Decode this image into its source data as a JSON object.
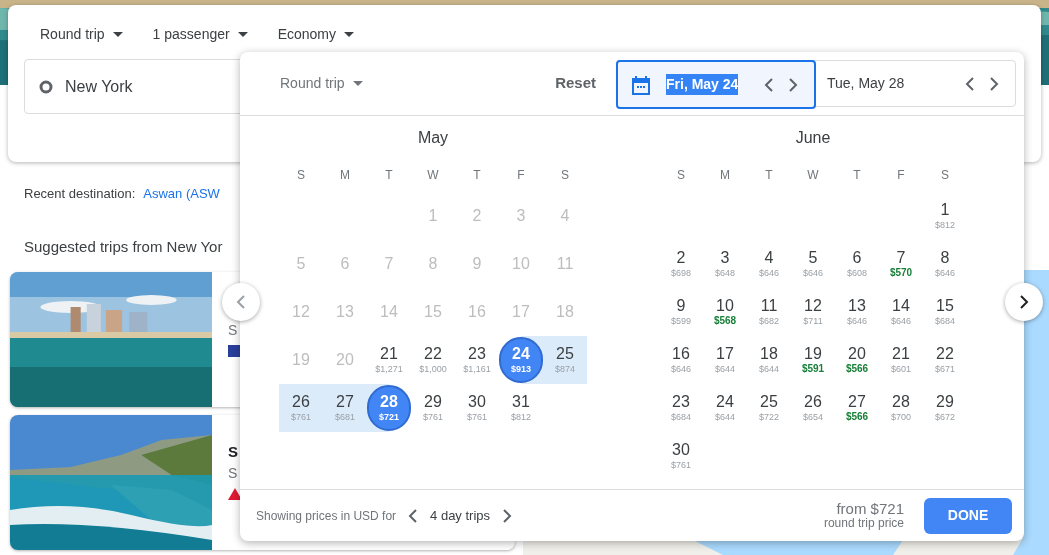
{
  "search": {
    "options": [
      {
        "label": "Round trip"
      },
      {
        "label": "1 passenger"
      },
      {
        "label": "Economy"
      }
    ],
    "origin": {
      "value": "New York"
    }
  },
  "recent": {
    "label": "Recent destination:",
    "link": "Aswan (ASW"
  },
  "suggested": {
    "heading": "Suggested trips from New Yor",
    "cards": [
      {
        "kind": "picture",
        "subtitle": "S",
        "logo": {
          "kind": "square"
        }
      },
      {
        "kind": "picture",
        "title": "S",
        "subtitle": "S",
        "logo": {
          "kind": "triangle"
        }
      }
    ]
  },
  "picker": {
    "trip_type": "Round trip",
    "reset": "Reset",
    "dates": [
      {
        "label": "Fri, May 24",
        "focused": true
      },
      {
        "label": "Tue, May 28",
        "focused": false
      }
    ],
    "months": [
      {
        "name": "May",
        "weekdays": [
          "S",
          "M",
          "T",
          "W",
          "T",
          "F",
          "S"
        ],
        "weeks": [
          {
            "kind": "trailing",
            "days": [
              {
                "day": "1",
                "disabled": true,
                "selected": false,
                "in_range": false
              },
              {
                "day": "2",
                "disabled": true,
                "selected": false,
                "in_range": false
              },
              {
                "day": "3",
                "disabled": true,
                "selected": false,
                "in_range": false
              },
              {
                "day": "4",
                "disabled": true,
                "selected": false,
                "in_range": false
              }
            ]
          },
          {
            "kind": "leading",
            "days": [
              {
                "day": "5",
                "disabled": true,
                "selected": false,
                "in_range": false
              },
              {
                "day": "6",
                "disabled": true,
                "selected": false,
                "in_range": false
              },
              {
                "day": "7",
                "disabled": true,
                "selected": false,
                "in_range": false
              },
              {
                "day": "8",
                "disabled": true,
                "selected": false,
                "in_range": false
              },
              {
                "day": "9",
                "disabled": true,
                "selected": false,
                "in_range": false
              },
              {
                "day": "10",
                "disabled": true,
                "selected": false,
                "in_range": false
              },
              {
                "day": "11",
                "disabled": true,
                "selected": false,
                "in_range": false
              }
            ]
          },
          {
            "kind": "leading",
            "days": [
              {
                "day": "12",
                "disabled": true,
                "selected": false,
                "in_range": false
              },
              {
                "day": "13",
                "disabled": true,
                "selected": false,
                "in_range": false
              },
              {
                "day": "14",
                "disabled": true,
                "selected": false,
                "in_range": false
              },
              {
                "day": "15",
                "disabled": true,
                "selected": false,
                "in_range": false
              },
              {
                "day": "16",
                "disabled": true,
                "selected": false,
                "in_range": false
              },
              {
                "day": "17",
                "disabled": true,
                "selected": false,
                "in_range": false
              },
              {
                "day": "18",
                "disabled": true,
                "selected": false,
                "in_range": false
              }
            ]
          },
          {
            "kind": "leading",
            "days": [
              {
                "day": "19",
                "disabled": true,
                "selected": false,
                "in_range": false
              },
              {
                "day": "20",
                "disabled": true,
                "selected": false,
                "in_range": false
              },
              {
                "day": "21",
                "price": "$1,271",
                "disabled": false,
                "selected": false,
                "in_range": false
              },
              {
                "day": "22",
                "price": "$1,000",
                "disabled": false,
                "selected": false,
                "in_range": false
              },
              {
                "day": "23",
                "price": "$1,161",
                "disabled": false,
                "selected": false,
                "in_range": false
              },
              {
                "day": "24",
                "price": "$913",
                "disabled": false,
                "selected": true,
                "in_range": false
              },
              {
                "day": "25",
                "price": "$874",
                "disabled": false,
                "selected": false,
                "in_range": true
              }
            ]
          },
          {
            "kind": "leading",
            "days": [
              {
                "day": "26",
                "price": "$761",
                "disabled": false,
                "selected": false,
                "in_range": true
              },
              {
                "day": "27",
                "price": "$681",
                "disabled": false,
                "selected": false,
                "in_range": true
              },
              {
                "day": "28",
                "price": "$721",
                "disabled": false,
                "selected": true,
                "in_range": false
              },
              {
                "day": "29",
                "price": "$761",
                "disabled": false,
                "selected": false,
                "in_range": false
              },
              {
                "day": "30",
                "price": "$761",
                "disabled": false,
                "selected": false,
                "in_range": false
              },
              {
                "day": "31",
                "price": "$812",
                "disabled": false,
                "selected": false,
                "in_range": false
              }
            ]
          }
        ]
      },
      {
        "name": "June",
        "weekdays": [
          "S",
          "M",
          "T",
          "W",
          "T",
          "F",
          "S"
        ],
        "weeks": [
          {
            "kind": "trailing",
            "days": [
              {
                "day": "1",
                "price": "$812",
                "disabled": false,
                "selected": false,
                "in_range": false
              }
            ]
          },
          {
            "kind": "leading",
            "days": [
              {
                "day": "2",
                "price": "$698",
                "disabled": false,
                "selected": false,
                "in_range": false
              },
              {
                "day": "3",
                "price": "$648",
                "disabled": false,
                "selected": false,
                "in_range": false
              },
              {
                "day": "4",
                "price": "$646",
                "disabled": false,
                "selected": false,
                "in_range": false
              },
              {
                "day": "5",
                "price": "$646",
                "disabled": false,
                "selected": false,
                "in_range": false
              },
              {
                "day": "6",
                "price": "$608",
                "disabled": false,
                "selected": false,
                "in_range": false
              },
              {
                "day": "7",
                "price": "$570",
                "color": "#188038",
                "disabled": false,
                "selected": false,
                "in_range": false
              },
              {
                "day": "8",
                "price": "$646",
                "disabled": false,
                "selected": false,
                "in_range": false
              }
            ]
          },
          {
            "kind": "leading",
            "days": [
              {
                "day": "9",
                "price": "$599",
                "disabled": false,
                "selected": false,
                "in_range": false
              },
              {
                "day": "10",
                "price": "$568",
                "color": "#188038",
                "disabled": false,
                "selected": false,
                "in_range": false
              },
              {
                "day": "11",
                "price": "$682",
                "disabled": false,
                "selected": false,
                "in_range": false
              },
              {
                "day": "12",
                "price": "$711",
                "disabled": false,
                "selected": false,
                "in_range": false
              },
              {
                "day": "13",
                "price": "$646",
                "disabled": false,
                "selected": false,
                "in_range": false
              },
              {
                "day": "14",
                "price": "$646",
                "disabled": false,
                "selected": false,
                "in_range": false
              },
              {
                "day": "15",
                "price": "$684",
                "disabled": false,
                "selected": false,
                "in_range": false
              }
            ]
          },
          {
            "kind": "leading",
            "days": [
              {
                "day": "16",
                "price": "$646",
                "disabled": false,
                "selected": false,
                "in_range": false
              },
              {
                "day": "17",
                "price": "$644",
                "disabled": false,
                "selected": false,
                "in_range": false
              },
              {
                "day": "18",
                "price": "$644",
                "disabled": false,
                "selected": false,
                "in_range": false
              },
              {
                "day": "19",
                "price": "$591",
                "color": "#188038",
                "disabled": false,
                "selected": false,
                "in_range": false
              },
              {
                "day": "20",
                "price": "$566",
                "color": "#188038",
                "disabled": false,
                "selected": false,
                "in_range": false
              },
              {
                "day": "21",
                "price": "$601",
                "disabled": false,
                "selected": false,
                "in_range": false
              },
              {
                "day": "22",
                "price": "$671",
                "disabled": false,
                "selected": false,
                "in_range": false
              }
            ]
          },
          {
            "kind": "leading",
            "days": [
              {
                "day": "23",
                "price": "$684",
                "disabled": false,
                "selected": false,
                "in_range": false
              },
              {
                "day": "24",
                "price": "$644",
                "disabled": false,
                "selected": false,
                "in_range": false
              },
              {
                "day": "25",
                "price": "$722",
                "disabled": false,
                "selected": false,
                "in_range": false
              },
              {
                "day": "26",
                "price": "$654",
                "disabled": false,
                "selected": false,
                "in_range": false
              },
              {
                "day": "27",
                "price": "$566",
                "color": "#188038",
                "disabled": false,
                "selected": false,
                "in_range": false
              },
              {
                "day": "28",
                "price": "$700",
                "disabled": false,
                "selected": false,
                "in_range": false
              },
              {
                "day": "29",
                "price": "$672",
                "disabled": false,
                "selected": false,
                "in_range": false
              }
            ]
          },
          {
            "kind": "leading",
            "days": [
              {
                "day": "30",
                "price": "$761",
                "disabled": false,
                "selected": false,
                "in_range": false
              }
            ]
          }
        ]
      }
    ],
    "footer": {
      "label": "Showing prices in USD for",
      "duration": "4 day trips",
      "price": "from $721",
      "price_note": "round trip price",
      "done": "DONE"
    }
  }
}
